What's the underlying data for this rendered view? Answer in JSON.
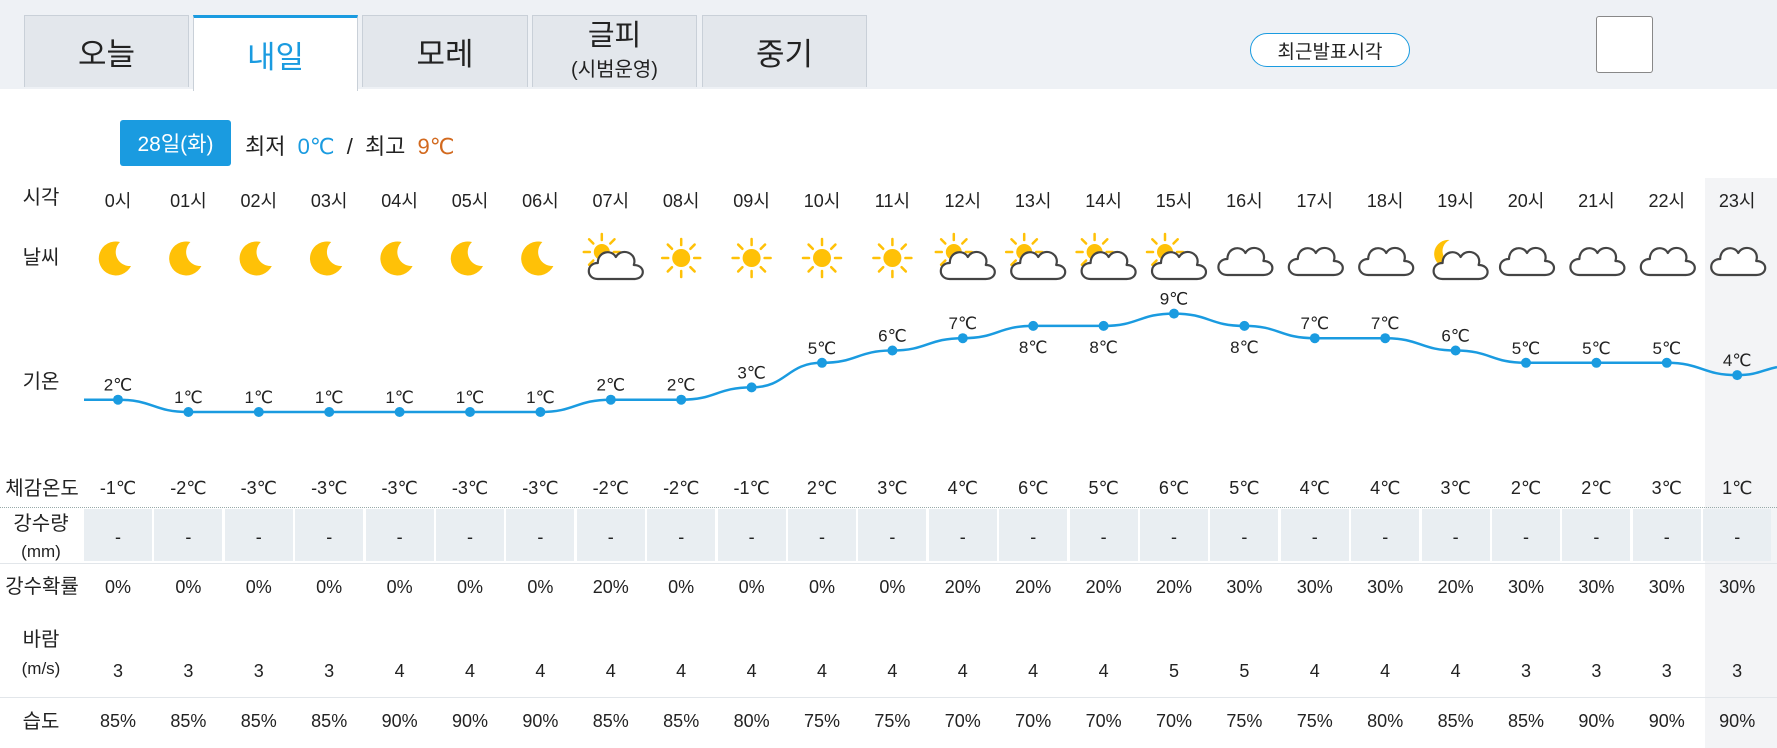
{
  "tabs": [
    {
      "label": "오늘",
      "sub": ""
    },
    {
      "label": "내일",
      "sub": ""
    },
    {
      "label": "모레",
      "sub": ""
    },
    {
      "label": "글피",
      "sub": "(시범운영)"
    },
    {
      "label": "중기",
      "sub": ""
    }
  ],
  "active_tab": 1,
  "recent_button": "최근발표시각",
  "date_badge": "28일(화)",
  "minmax": {
    "min_label": "최저",
    "min_value": "0℃",
    "sep": "/",
    "max_label": "최고",
    "max_value": "9℃"
  },
  "row_labels": {
    "time": "시각",
    "weather": "날씨",
    "temp": "기온",
    "feels": "체감온도",
    "precip_line1": "강수량",
    "precip_line2": "(mm)",
    "prob": "강수확률",
    "wind_line1": "바람",
    "wind_line2": "(m/s)",
    "humidity": "습도"
  },
  "hours": [
    "0시",
    "01시",
    "02시",
    "03시",
    "04시",
    "05시",
    "06시",
    "07시",
    "08시",
    "09시",
    "10시",
    "11시",
    "12시",
    "13시",
    "14시",
    "15시",
    "16시",
    "17시",
    "18시",
    "19시",
    "20시",
    "21시",
    "22시",
    "23시"
  ],
  "weather": [
    "moon",
    "moon",
    "moon",
    "moon",
    "moon",
    "moon",
    "moon",
    "sun-cloud",
    "sun",
    "sun",
    "sun",
    "sun",
    "sun-cloud",
    "sun-cloud",
    "sun-cloud",
    "sun-cloud",
    "cloud",
    "cloud",
    "cloud",
    "moon-cloud",
    "cloud",
    "cloud",
    "cloud",
    "cloud"
  ],
  "temps": [
    2,
    1,
    1,
    1,
    1,
    1,
    1,
    2,
    2,
    3,
    5,
    6,
    7,
    8,
    8,
    9,
    8,
    7,
    7,
    6,
    5,
    5,
    5,
    4
  ],
  "temp_unit": "℃",
  "feels": [
    "-1℃",
    "-2℃",
    "-3℃",
    "-3℃",
    "-3℃",
    "-3℃",
    "-3℃",
    "-2℃",
    "-2℃",
    "-1℃",
    "2℃",
    "3℃",
    "4℃",
    "6℃",
    "5℃",
    "6℃",
    "5℃",
    "4℃",
    "4℃",
    "3℃",
    "2℃",
    "2℃",
    "3℃",
    "1℃"
  ],
  "precip": [
    "-",
    "-",
    "-",
    "-",
    "-",
    "-",
    "-",
    "-",
    "-",
    "-",
    "-",
    "-",
    "-",
    "-",
    "-",
    "-",
    "-",
    "-",
    "-",
    "-",
    "-",
    "-",
    "-",
    "-"
  ],
  "prob": [
    "0%",
    "0%",
    "0%",
    "0%",
    "0%",
    "0%",
    "0%",
    "20%",
    "0%",
    "0%",
    "0%",
    "0%",
    "20%",
    "20%",
    "20%",
    "20%",
    "30%",
    "30%",
    "30%",
    "20%",
    "30%",
    "30%",
    "30%",
    "30%"
  ],
  "wind": [
    "3",
    "3",
    "3",
    "3",
    "4",
    "4",
    "4",
    "4",
    "4",
    "4",
    "4",
    "4",
    "4",
    "4",
    "4",
    "5",
    "5",
    "4",
    "4",
    "4",
    "3",
    "3",
    "3",
    "3"
  ],
  "humidity": [
    "85%",
    "85%",
    "85%",
    "85%",
    "90%",
    "90%",
    "90%",
    "85%",
    "85%",
    "80%",
    "75%",
    "75%",
    "70%",
    "70%",
    "70%",
    "70%",
    "75%",
    "75%",
    "80%",
    "85%",
    "85%",
    "90%",
    "90%",
    "90%"
  ],
  "colors": {
    "accent": "#1a9be0",
    "max_temp": "#d2691e",
    "sun": "#ffc107",
    "line": "#1a9be0"
  }
}
